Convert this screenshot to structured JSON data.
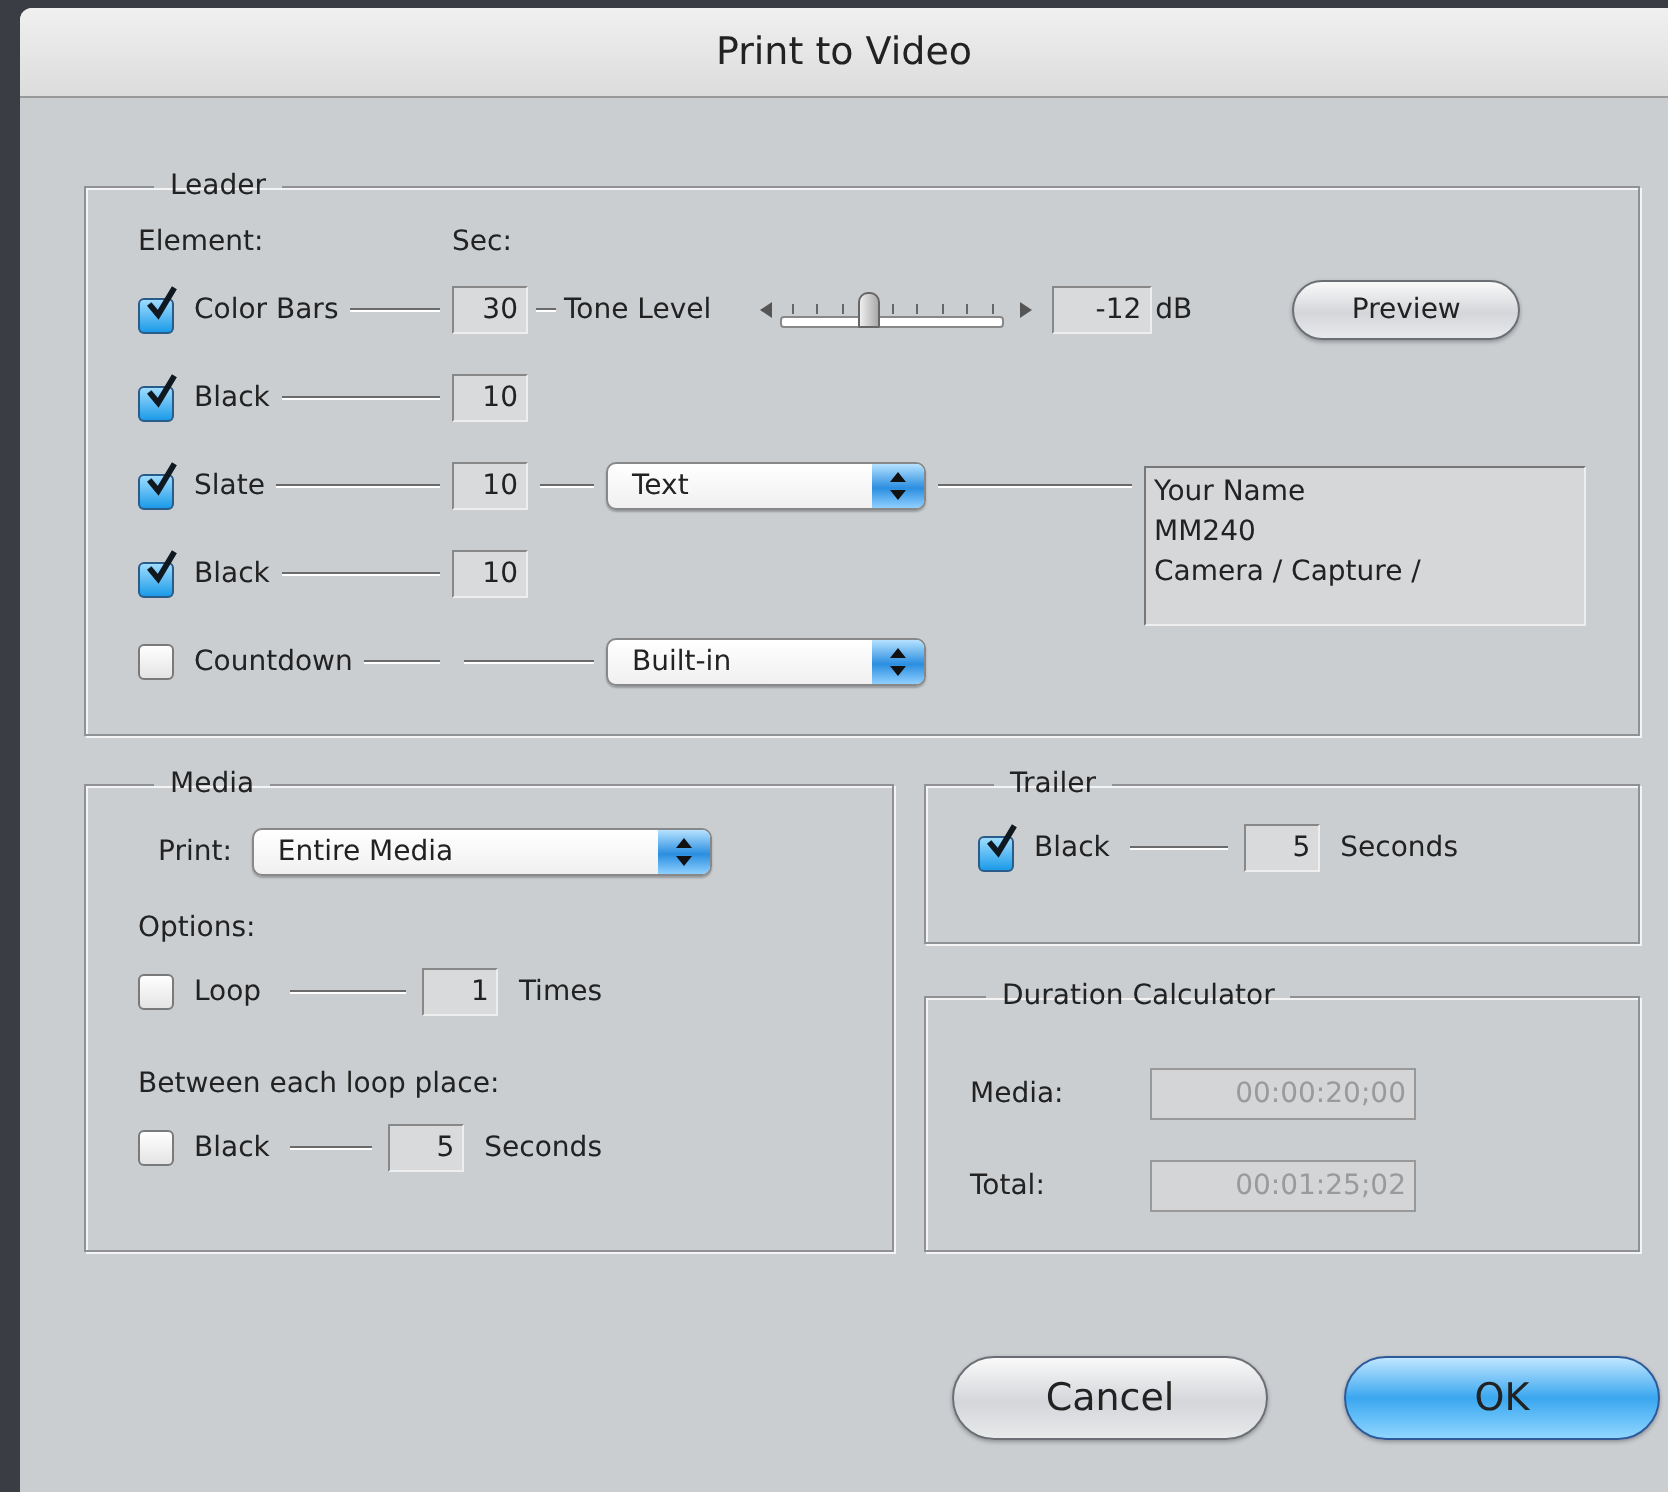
{
  "window": {
    "title": "Print to Video"
  },
  "leader": {
    "title": "Leader",
    "element_heading": "Element:",
    "sec_heading": "Sec:",
    "rows": [
      {
        "kind": "bars",
        "label": "Color Bars",
        "checked": true,
        "seconds": "30"
      },
      {
        "kind": "plain",
        "label": "Black",
        "checked": true,
        "seconds": "10"
      },
      {
        "kind": "slate",
        "label": "Slate",
        "checked": true,
        "seconds": "10"
      },
      {
        "kind": "plain",
        "label": "Black",
        "checked": true,
        "seconds": "10"
      },
      {
        "kind": "countdown",
        "label": "Countdown",
        "checked": false
      }
    ],
    "tone": {
      "label": "Tone Level",
      "level": 0.38,
      "value": "-12",
      "unit": "dB"
    },
    "preview_button": "Preview",
    "slate_source": "Text",
    "slate_text": "Your Name\nMM240\nCamera / Capture /",
    "countdown_source": "Built-in"
  },
  "media": {
    "title": "Media",
    "print_label": "Print:",
    "print_value": "Entire Media",
    "options_heading": "Options:",
    "loop": {
      "label": "Loop",
      "checked": false,
      "value": "1",
      "unit": "Times"
    },
    "between_heading": "Between each loop place:",
    "between": {
      "label": "Black",
      "checked": false,
      "value": "5",
      "unit": "Seconds"
    }
  },
  "trailer": {
    "title": "Trailer",
    "black": {
      "label": "Black",
      "checked": true,
      "value": "5",
      "unit": "Seconds"
    }
  },
  "duration": {
    "title": "Duration Calculator",
    "media_label": "Media:",
    "media_value": "00:00:20;00",
    "total_label": "Total:",
    "total_value": "00:01:25;02"
  },
  "buttons": [
    {
      "label": "Cancel",
      "default": false
    },
    {
      "label": "OK",
      "default": true
    }
  ]
}
